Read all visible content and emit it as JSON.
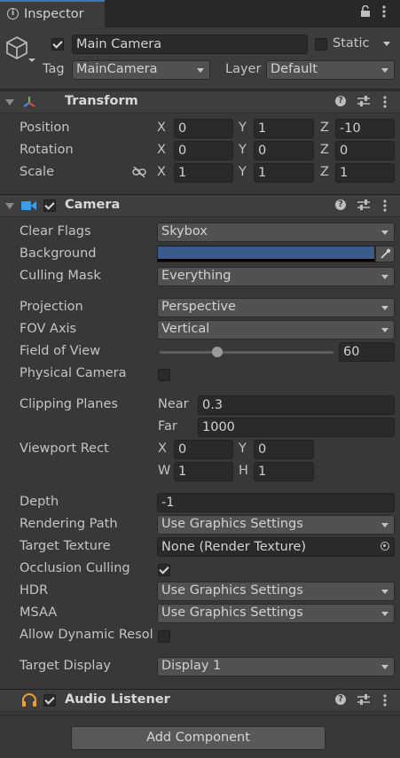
{
  "tab": {
    "label": "Inspector"
  },
  "object": {
    "name": "Main Camera",
    "static_label": "Static",
    "tag_label": "Tag",
    "tag_value": "MainCamera",
    "layer_label": "Layer",
    "layer_value": "Default"
  },
  "transform": {
    "title": "Transform",
    "position_label": "Position",
    "rotation_label": "Rotation",
    "scale_label": "Scale",
    "x": "X",
    "y": "Y",
    "z": "Z",
    "position": {
      "x": "0",
      "y": "1",
      "z": "-10"
    },
    "rotation": {
      "x": "0",
      "y": "0",
      "z": "0"
    },
    "scale": {
      "x": "1",
      "y": "1",
      "z": "1"
    }
  },
  "camera": {
    "title": "Camera",
    "clear_flags_label": "Clear Flags",
    "clear_flags": "Skybox",
    "background_label": "Background",
    "background_color": "#3b5a8c",
    "culling_mask_label": "Culling Mask",
    "culling_mask": "Everything",
    "projection_label": "Projection",
    "projection": "Perspective",
    "fov_axis_label": "FOV Axis",
    "fov_axis": "Vertical",
    "fov_label": "Field of View",
    "fov": "60",
    "fov_fraction": 0.33,
    "physical_label": "Physical Camera",
    "clipping_label": "Clipping Planes",
    "near_label": "Near",
    "near": "0.3",
    "far_label": "Far",
    "far": "1000",
    "viewport_label": "Viewport Rect",
    "vp_x_label": "X",
    "vp_x": "0",
    "vp_y_label": "Y",
    "vp_y": "0",
    "vp_w_label": "W",
    "vp_w": "1",
    "vp_h_label": "H",
    "vp_h": "1",
    "depth_label": "Depth",
    "depth": "-1",
    "rendering_label": "Rendering Path",
    "rendering": "Use Graphics Settings",
    "target_texture_label": "Target Texture",
    "target_texture": "None (Render Texture)",
    "occlusion_label": "Occlusion Culling",
    "hdr_label": "HDR",
    "hdr": "Use Graphics Settings",
    "msaa_label": "MSAA",
    "msaa": "Use Graphics Settings",
    "dynamic_label": "Allow Dynamic Resol",
    "target_display_label": "Target Display",
    "target_display": "Display 1"
  },
  "audio": {
    "title": "Audio Listener"
  },
  "add_component": "Add Component"
}
